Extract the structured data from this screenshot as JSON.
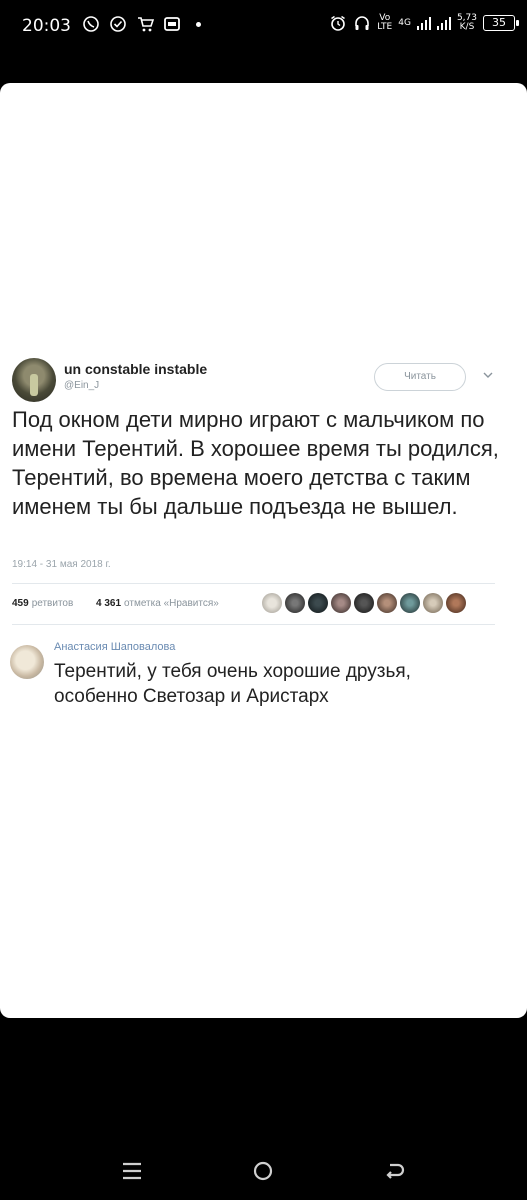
{
  "status_bar": {
    "time": "20:03",
    "net_top": "Vo",
    "net_bottom": "LTE",
    "gen": "4G",
    "speed_top": "5,73",
    "speed_bottom": "K/S",
    "battery": "35"
  },
  "tweet": {
    "display_name": "un constable instable",
    "handle": "@Ein_J",
    "follow_label": "Читать",
    "text": "Под окном дети мирно играют с мальчиком по имени Терентий. В хорошее время ты родился, Терентий, во времена моего детства с таким именем ты бы дальше подъезда не вышел.",
    "timestamp": "19:14 - 31 мая 2018 г.",
    "retweets_count": "459",
    "retweets_label": "ретвитов",
    "likes_count": "4 361",
    "likes_label": "отметка «Нравится»"
  },
  "reply": {
    "name": "Анастасия Шаповалова",
    "text": "Терентий, у тебя очень хорошие друзья, особенно Светозар и Аристарх"
  },
  "colors": {
    "background": "#000000",
    "card": "#ffffff",
    "reply_name": "#6a8bb2",
    "muted": "#8a949c"
  }
}
